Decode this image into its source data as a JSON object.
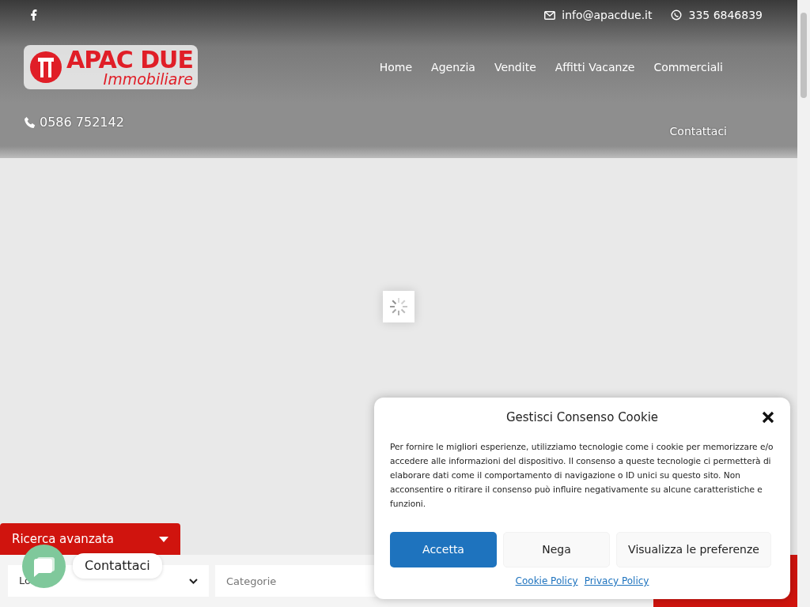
{
  "topbar": {
    "email": "info@apacdue.it",
    "whatsapp": "335 6846839"
  },
  "logo": {
    "name": "APAC DUE",
    "tagline": "Immobiliare"
  },
  "nav": [
    {
      "label": "Home"
    },
    {
      "label": "Agenzia"
    },
    {
      "label": "Vendite"
    },
    {
      "label": "Affitti Vacanze"
    },
    {
      "label": "Commerciali"
    },
    {
      "label": "Contattaci"
    }
  ],
  "phone": "0586 752142",
  "search": {
    "toggle": "Ricerca avanzata",
    "fields": [
      {
        "value": "Lo",
        "kind": "select"
      },
      {
        "placeholder": "Categorie",
        "kind": "input"
      }
    ]
  },
  "chat": {
    "label": "Contattaci"
  },
  "cookie_dialog": {
    "title": "Gestisci Consenso Cookie",
    "text": "Per fornire le migliori esperienze, utilizziamo tecnologie come i cookie per memorizzare e/o accedere alle informazioni del dispositivo. Il consenso a queste tecnologie ci permetterà di elaborare dati come il comportamento di navigazione o ID unici su questo sito. Non acconsentire o ritirare il consenso può influire negativamente su alcune caratteristiche e funzioni.",
    "buttons": [
      {
        "label": "Accetta",
        "kind": "primary"
      },
      {
        "label": "Nega",
        "kind": "secondary"
      },
      {
        "label": "Visualizza le preferenze",
        "kind": "secondary"
      }
    ],
    "links": [
      {
        "label": "Cookie Policy"
      },
      {
        "label": "Privacy Policy"
      }
    ]
  }
}
